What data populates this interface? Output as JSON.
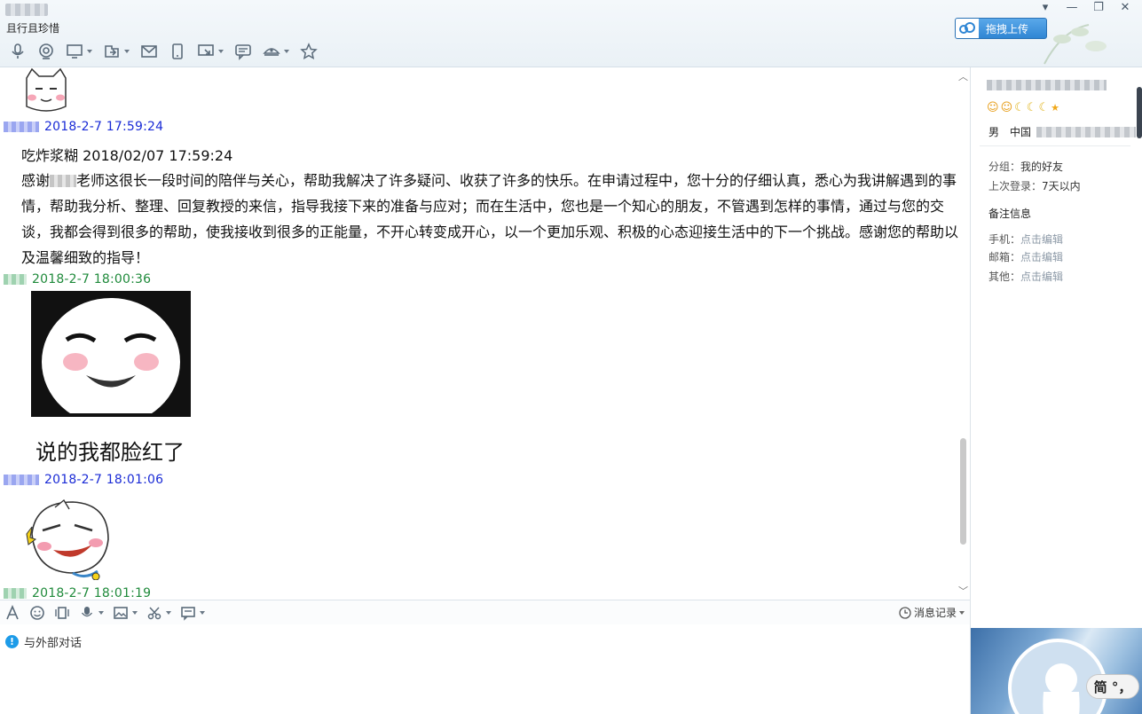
{
  "header": {
    "signature": "且行且珍惜",
    "upload_label": "拖拽上传",
    "window_controls": [
      "▾",
      "—",
      "❐",
      "✕"
    ],
    "toolbar_icons": [
      "microphone-icon",
      "video-call-icon",
      "screen-share-icon",
      "file-transfer-icon",
      "mail-icon",
      "phone-icon",
      "remote-desktop-icon",
      "group-chat-icon",
      "app-center-icon",
      "favorite-icon"
    ]
  },
  "chat": {
    "messages": [
      {
        "timestamp": "2018-2-7 17:59:24",
        "color": "#1a2bd6"
      },
      {
        "timestamp": "2018-2-7 18:00:36",
        "color": "#1f8a3b"
      },
      {
        "timestamp": "2018-2-7 18:01:06",
        "color": "#1a2bd6"
      },
      {
        "timestamp": "2018-2-7 18:01:19",
        "color": "#1f8a3b"
      }
    ],
    "message_title": "吃炸浆糊 2018/02/07 17:59:24",
    "message_body_start": "感谢",
    "message_body_rest": "老师这很长一段时间的陪伴与关心，帮助我解决了许多疑问、收获了许多的快乐。在申请过程中，您十分的仔细认真，悉心为我讲解遇到的事情，帮助我分析、整理、回复教授的来信，指导我接下来的准备与应对；而在生活中，您也是一个知心的朋友，不管遇到怎样的事情，通过与您的交谈，我都会得到很多的帮助，使我接收到很多的正能量，不开心转变成开心，以一个更加乐观、积极的心态迎接生活中的下一个挑战。感谢您的帮助以及温馨细致的指导！",
    "sticker_caption": "说的我都脸红了"
  },
  "input": {
    "history_label": "消息记录",
    "external_notice": "与外部对话",
    "toolbar_icons": [
      "font-icon",
      "emoji-icon",
      "shake-icon",
      "voice-icon",
      "image-icon",
      "screenshot-icon",
      "quick-reply-icon"
    ]
  },
  "profile": {
    "gender": "男",
    "country": "中国",
    "group_label": "分组：",
    "group_value": "我的好友",
    "last_login_label": "上次登录：",
    "last_login_value": "7天以内",
    "remarks_heading": "备注信息",
    "phone_label": "手机：",
    "email_label": "邮箱：",
    "other_label": "其他：",
    "edit_link": "点击编辑",
    "ime_label": "简 °，"
  }
}
